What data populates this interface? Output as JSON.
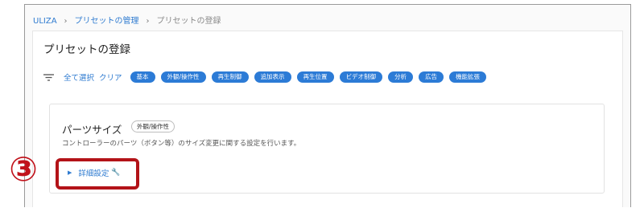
{
  "breadcrumb": {
    "home": "ULIZA",
    "sep": "›",
    "preset_manage": "プリセットの管理",
    "current": "プリセットの登録"
  },
  "page": {
    "title": "プリセットの登録"
  },
  "filter": {
    "icon": "filter-list-icon",
    "select_all": "全て選択",
    "clear": "クリア",
    "chips": [
      "基本",
      "外観/操作性",
      "再生制御",
      "追加表示",
      "再生位置",
      "ビデオ制御",
      "分析",
      "広告",
      "機能拡張"
    ],
    "chip_color": "#2c7bd6"
  },
  "parts_card": {
    "title": "パーツサイズ",
    "badge": "外観/操作性",
    "description": "コントローラーのパーツ（ボタン等）のサイズ変更に関する設定を行います。",
    "detail_toggle": "詳細設定",
    "detail_icon": "wrench-icon"
  },
  "annotation": {
    "step_number": "③",
    "color": "#c1121b"
  }
}
